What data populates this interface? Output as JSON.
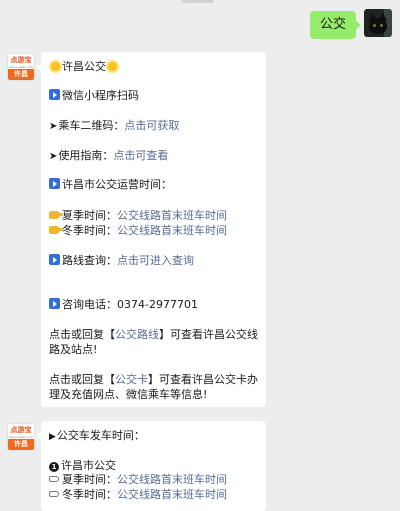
{
  "chat": {
    "outgoing": {
      "text": "公交"
    },
    "reply1": {
      "title": "许昌公交",
      "wechat_scan": "微信小程序扫码",
      "qr_label": "乘车二维码：",
      "qr_link": "点击可获取",
      "guide_label": "使用指南：",
      "guide_link": "点击可查看",
      "hours_heading": "许昌市公交运营时间：",
      "summer_label": "夏季时间：",
      "summer_link": "公交线路首末班车时间",
      "winter_label": "冬季时间：",
      "winter_link": "公交线路首末班车时间",
      "route_label": "路线查询：",
      "route_link": "点击可进入查询",
      "phone": "咨询电话：0374-2977701",
      "reply_a_pre": "点击或回复【",
      "reply_a_kw": "公交路线",
      "reply_a_post": "】可查看许昌公交线路及站点!",
      "reply_b_pre": "点击或回复【",
      "reply_b_kw": "公交卡",
      "reply_b_post": "】可查看许昌公交卡办理及充值网点、微信乘车等信息!"
    },
    "reply2": {
      "heading": "公交车发车时间：",
      "city": "许昌市公交",
      "summer_label": "夏季时间：",
      "summer_link": "公交线路首末班车时间",
      "winter_label": "冬季时间：",
      "winter_link": "公交线路首末班车时间"
    }
  },
  "bot_avatar": {
    "logo_text": "点游宝",
    "logo_url": "dianyoubao.com",
    "city": "许昌"
  },
  "icons": {
    "blue_play": "play-square-icon",
    "sun": "sun-emoji-icon",
    "pointing_hand": "pointing-hand-icon",
    "arrow": "arrow-right-icon",
    "number_one": "circled-one-icon"
  },
  "colors": {
    "outgoing_bubble": "#95ec69",
    "link": "#576b95",
    "background": "#ededed"
  }
}
